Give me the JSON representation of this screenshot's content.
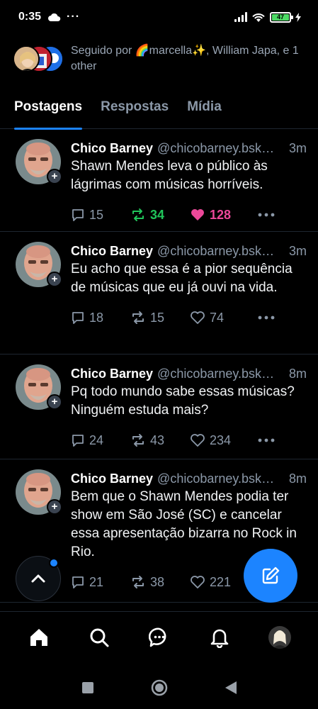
{
  "status_bar": {
    "time": "0:35",
    "battery": "47"
  },
  "followers": {
    "text": "Seguido por 🌈marcella✨, William Japa, e 1 other"
  },
  "tabs": [
    {
      "label": "Postagens",
      "active": true
    },
    {
      "label": "Respostas",
      "active": false
    },
    {
      "label": "Mídia",
      "active": false
    }
  ],
  "posts": [
    {
      "name": "Chico Barney",
      "handle": "@chicobarney.bsky.social",
      "time": "3m",
      "text": "Shawn Mendes leva o público às lágrimas com músicas horríveis.",
      "replies": "15",
      "reposts": "34",
      "likes": "128"
    },
    {
      "name": "Chico Barney",
      "handle": "@chicobarney.bsky.social",
      "time": "3m",
      "text": "Eu acho que essa é a pior sequência de músicas que eu já ouvi na vida.",
      "replies": "18",
      "reposts": "15",
      "likes": "74"
    },
    {
      "name": "Chico Barney",
      "handle": "@chicobarney.bsky.social",
      "time": "8m",
      "text": "Pq todo mundo sabe essas músicas? Ninguém estuda mais?",
      "replies": "24",
      "reposts": "43",
      "likes": "234"
    },
    {
      "name": "Chico Barney",
      "handle": "@chicobarney.bsky.social",
      "time": "8m",
      "text": "Bem que o Shawn Mendes podia ter show em São José (SC) e cancelar essa apresentação bizarra no Rock in Rio.",
      "replies": "21",
      "reposts": "38",
      "likes": "221"
    }
  ],
  "icons": {
    "reply": "speech-bubble-icon",
    "repost": "repost-icon",
    "like": "heart-icon",
    "more": "more-dots-icon",
    "nav": [
      "home-icon",
      "search-icon",
      "chat-icon",
      "bell-icon",
      "profile-avatar"
    ],
    "system_nav": [
      "recents-square-icon",
      "home-circle-icon",
      "back-triangle-icon"
    ]
  },
  "colors": {
    "accent": "#1c84ff",
    "repost_active": "#20c45a",
    "like_active": "#ec4899",
    "muted": "#8b98a8",
    "background": "#000000"
  }
}
